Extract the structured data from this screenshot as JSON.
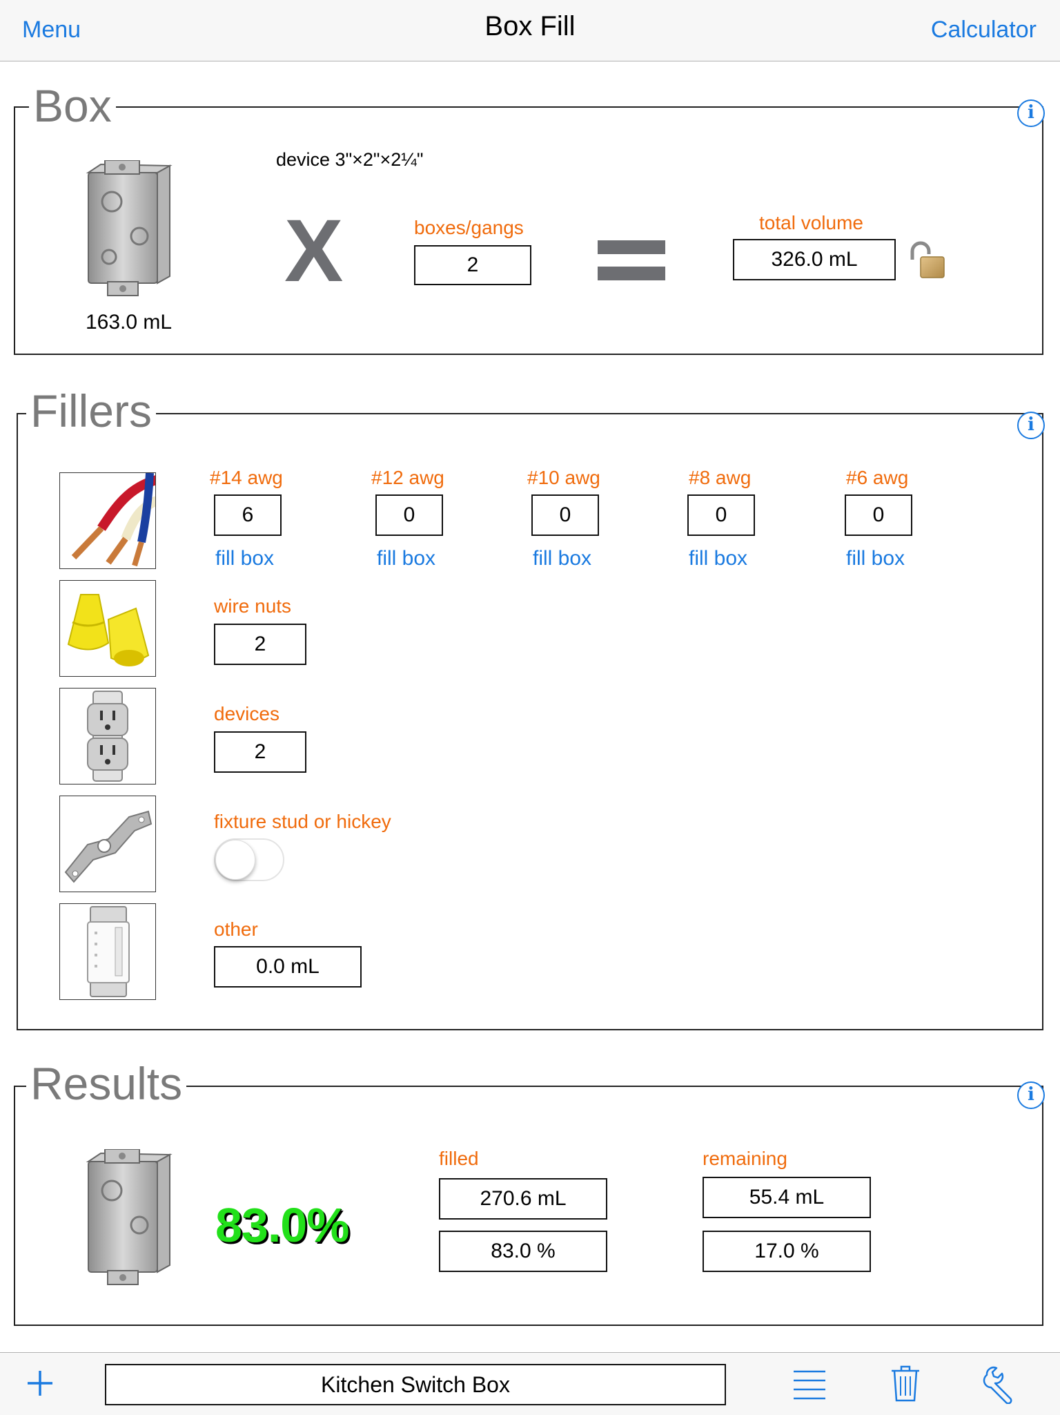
{
  "nav": {
    "left": "Menu",
    "title": "Box Fill",
    "right": "Calculator"
  },
  "box": {
    "section_title": "Box",
    "device_label": "device 3\"×2\"×2¼\"",
    "box_volume": "163.0 mL",
    "times_symbol": "X",
    "gangs_label": "boxes/gangs",
    "gangs_value": "2",
    "total_label": "total volume",
    "total_value": "326.0 mL"
  },
  "fillers": {
    "section_title": "Fillers",
    "wires": [
      {
        "label": "#14 awg",
        "value": "6",
        "action": "fill box"
      },
      {
        "label": "#12 awg",
        "value": "0",
        "action": "fill box"
      },
      {
        "label": "#10 awg",
        "value": "0",
        "action": "fill box"
      },
      {
        "label": "#8 awg",
        "value": "0",
        "action": "fill box"
      },
      {
        "label": "#6 awg",
        "value": "0",
        "action": "fill box"
      }
    ],
    "wire_nuts": {
      "label": "wire nuts",
      "value": "2"
    },
    "devices": {
      "label": "devices",
      "value": "2"
    },
    "fixture": {
      "label": "fixture stud or hickey",
      "on": false
    },
    "other": {
      "label": "other",
      "value": "0.0 mL"
    }
  },
  "results": {
    "section_title": "Results",
    "percent": "83.0%",
    "filled_label": "filled",
    "filled_ml": "270.6 mL",
    "filled_pct": "83.0 %",
    "remaining_label": "remaining",
    "remaining_ml": "55.4 mL",
    "remaining_pct": "17.0 %",
    "fill_fraction": 0.83
  },
  "toolbar": {
    "project_name": "Kitchen Switch Box"
  },
  "icons": [
    "info-icon",
    "lock-open-icon",
    "plus-icon",
    "list-icon",
    "trash-icon",
    "wrench-icon"
  ],
  "colors": {
    "accent": "#1a7ae0",
    "label": "#f06b0c",
    "result_good": "#22e01a"
  }
}
